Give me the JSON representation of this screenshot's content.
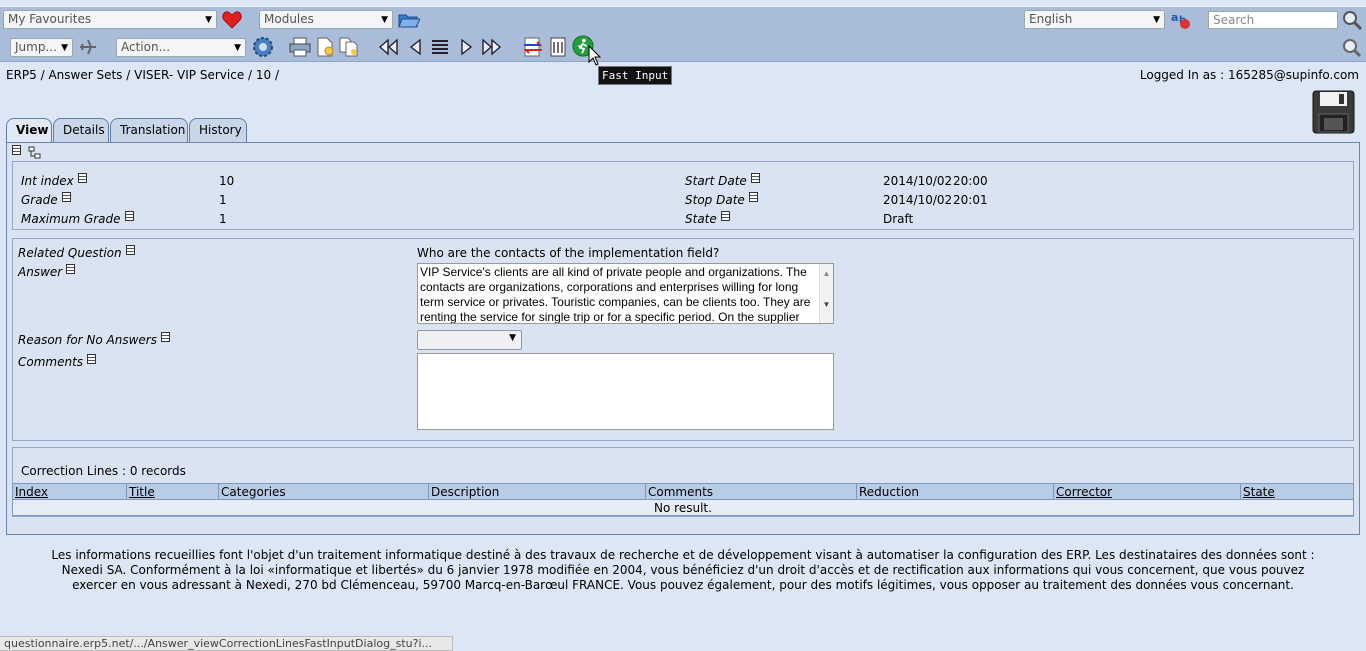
{
  "toolbar": {
    "favourites": "My Favourites",
    "modules": "Modules",
    "language": "English",
    "search_placeholder": "Search",
    "jump": "Jump...",
    "action": "Action...",
    "tooltip": "Fast Input"
  },
  "header": {
    "breadcrumb": "ERP5 / Answer Sets / VISER- VIP Service / 10 /",
    "logged_in": "Logged In as : 165285@supinfo.com"
  },
  "tabs": [
    {
      "label": "View"
    },
    {
      "label": "Details"
    },
    {
      "label": "Translation"
    },
    {
      "label": "History"
    }
  ],
  "fields": {
    "int_index_label": "Int index",
    "int_index_value": "10",
    "grade_label": "Grade",
    "grade_value": "1",
    "max_grade_label": "Maximum Grade",
    "max_grade_value": "1",
    "start_date_label": "Start Date",
    "start_date_value": "2014/10/02",
    "start_time_value": "20:00",
    "stop_date_label": "Stop Date",
    "stop_date_value": "2014/10/02",
    "stop_time_value": "20:01",
    "state_label": "State",
    "state_value": "Draft",
    "related_question_label": "Related Question",
    "related_question_value": "Who are the contacts of the implementation field?",
    "answer_label": "Answer",
    "answer_value": "VIP Service's clients are all kind of private people and organizations. The contacts are organizations, corporations and enterprises willing for long term service or privates. Touristic companies, can be clients too. They are renting the service for single trip or for a specific period.  On the supplier",
    "reason_label": "Reason for No Answers",
    "comments_label": "Comments",
    "comments_value": ""
  },
  "listbox": {
    "title": "Correction Lines :",
    "count": "0 records",
    "columns": [
      "Index",
      "Title",
      "Categories",
      "Description",
      "Comments",
      "Reduction",
      "Corrector",
      "State"
    ],
    "empty": "No result."
  },
  "footer": {
    "text": "Les informations recueillies font l'objet d'un traitement informatique destiné à des travaux de recherche et de développement visant à automatiser la configuration des ERP. Les destinataires des données sont : Nexedi SA. Conformément à la loi «informatique et libertés» du 6 janvier 1978 modifiée en 2004, vous bénéficiez d'un droit d'accès et de rectification aux informations qui vous concernent, que vous pouvez exercer en vous adressant à Nexedi, 270 bd Clémenceau, 59700 Marcq-en-Barœul FRANCE. Vous pouvez également, pour des motifs légitimes, vous opposer au traitement des données vous concernant."
  },
  "status_bar": "questionnaire.erp5.net/.../Answer_viewCorrectionLinesFastInputDialog_stu?i..."
}
